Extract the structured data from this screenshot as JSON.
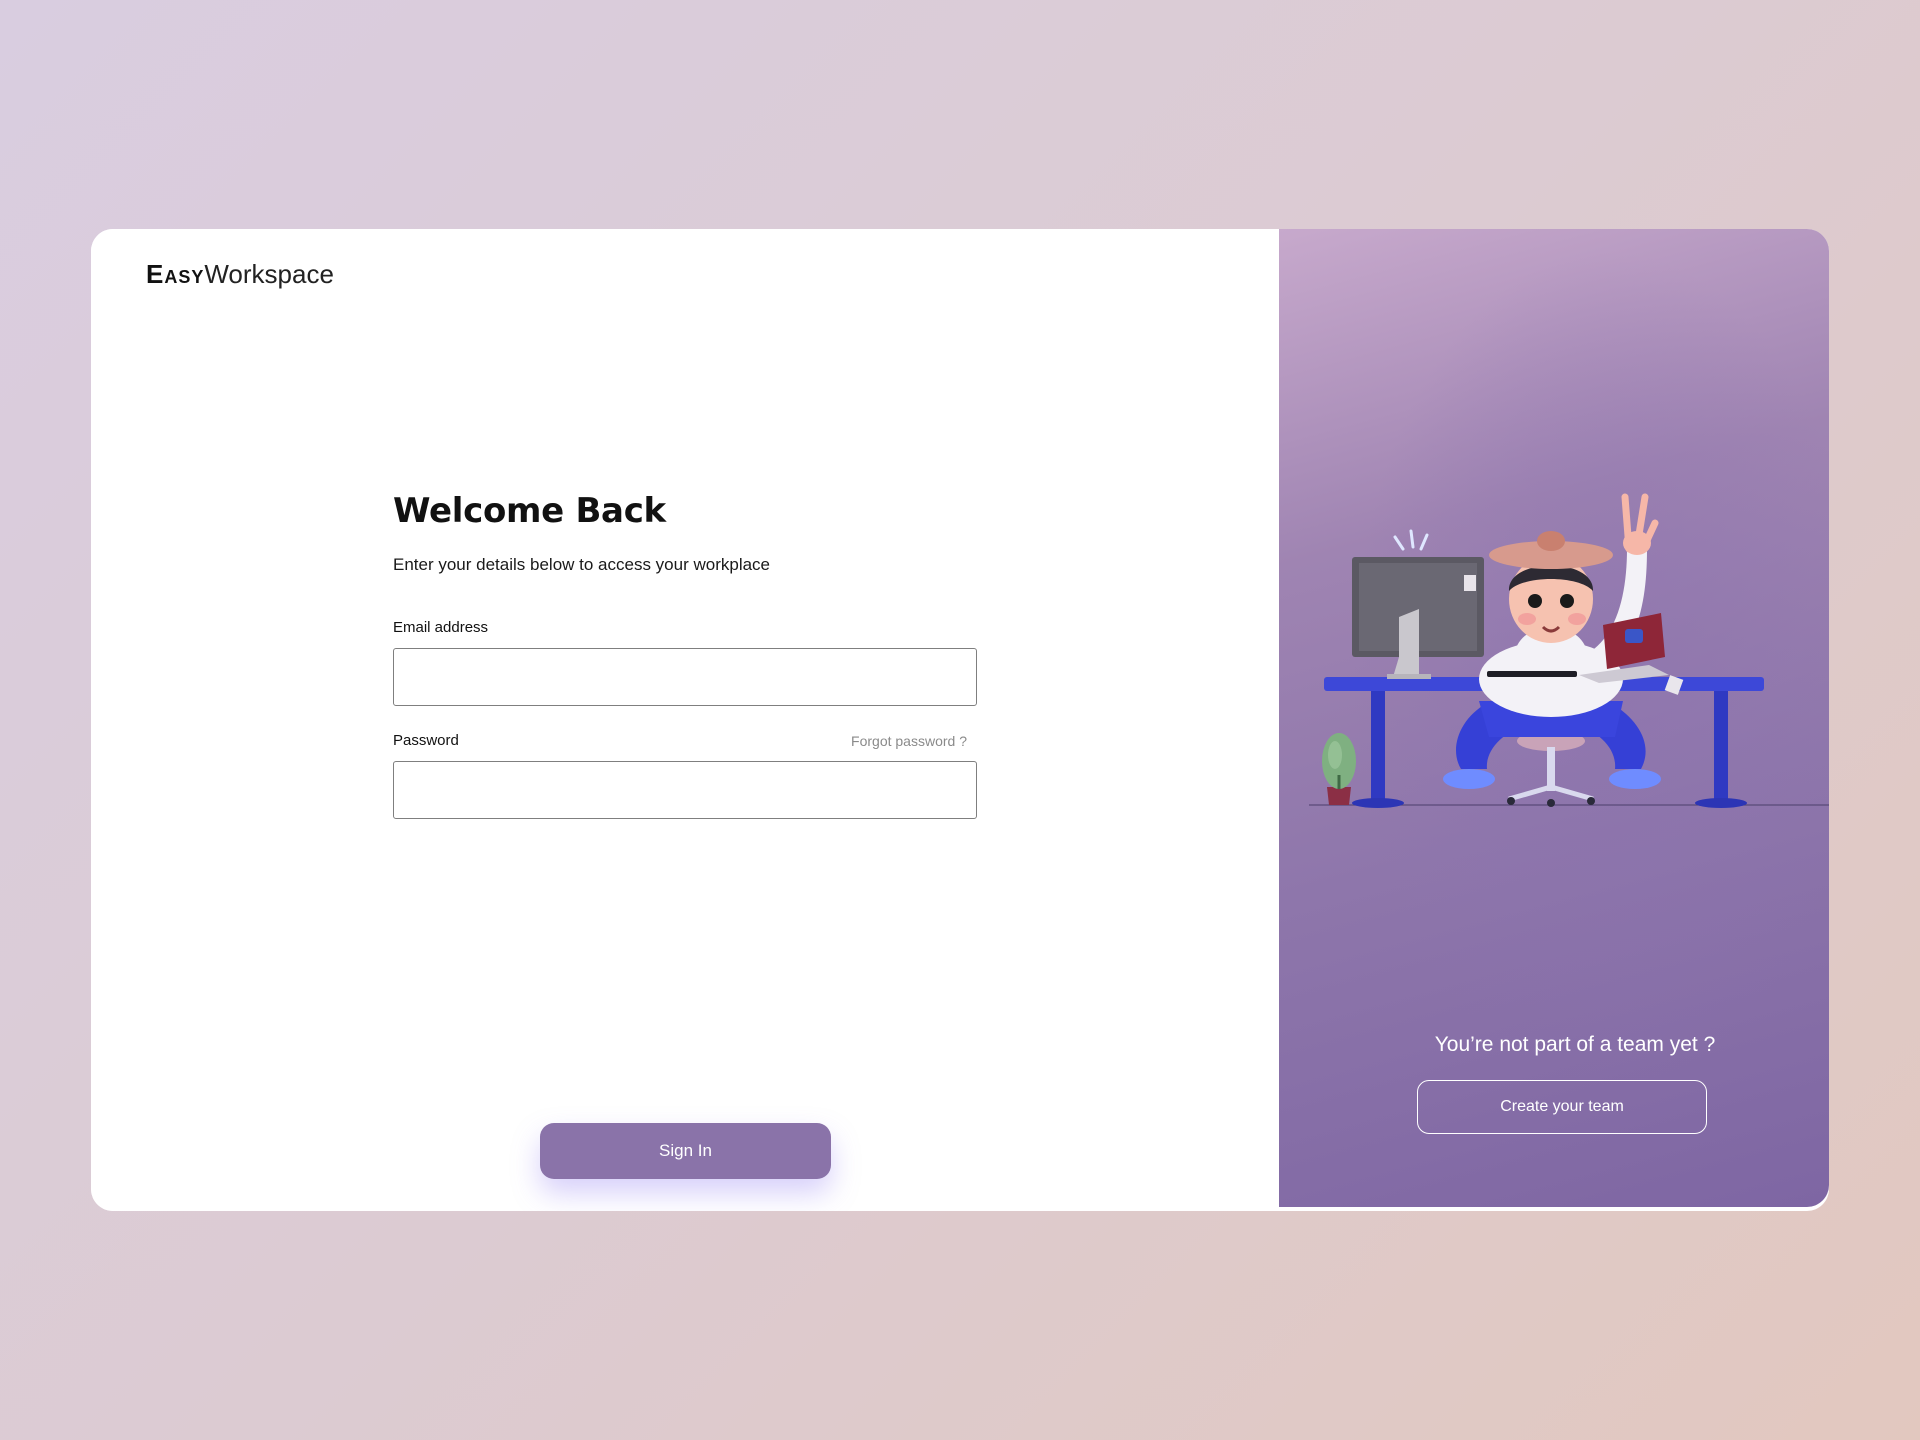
{
  "brand": {
    "name_bold": "Easy",
    "name_regular": "Workspace"
  },
  "login": {
    "title": "Welcome Back",
    "subtitle": "Enter your details below to access your workplace",
    "email_label": "Email address",
    "email_value": "",
    "password_label": "Password",
    "password_value": "",
    "forgot_link": "Forgot password ?",
    "submit_label": "Sign In"
  },
  "side_panel": {
    "tagline": "You’re not part of a team yet ?",
    "create_button": "Create your team"
  },
  "colors": {
    "accent": "#8a73a9",
    "panel_top": "#c7a9cc",
    "panel_bottom": "#7e66a3"
  }
}
